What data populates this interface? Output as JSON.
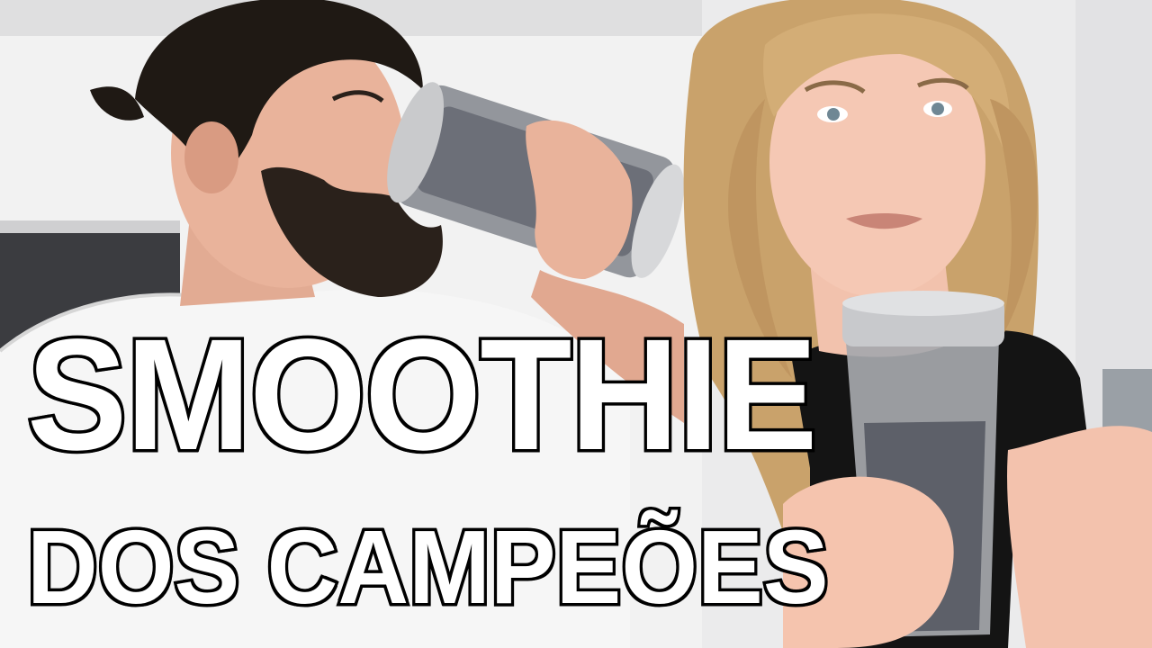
{
  "thumbnail": {
    "title_line_1": "SMOOTHIE",
    "title_line_2": "DOS CAMPEÕES"
  },
  "colors": {
    "title_fill": "#ffffff",
    "title_outline": "#000000",
    "background_wall": "#e9e9ea",
    "smoothie": "#6c6f78"
  },
  "scene": {
    "left_person": "bearded man in white t-shirt drinking from blender cup",
    "right_person": "blonde woman in black top holding blender cup"
  }
}
